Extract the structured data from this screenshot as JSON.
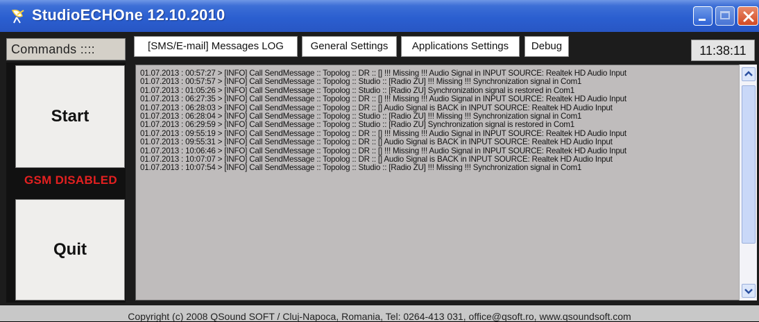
{
  "window": {
    "title": "StudioECHOne 12.10.2010"
  },
  "toolbar": {
    "commands_label": "Commands ::::",
    "tabs": [
      {
        "label": "[SMS/E-mail] Messages LOG"
      },
      {
        "label": "General Settings"
      },
      {
        "label": "Applications Settings"
      },
      {
        "label": "Debug"
      }
    ],
    "clock": "11:38:11"
  },
  "left": {
    "start_label": "Start",
    "gsm_status": "GSM DISABLED",
    "quit_label": "Quit"
  },
  "log": {
    "lines": [
      "01.07.2013 : 00:57:27 > [INFO] Call SendMessage :: Topolog :: DR :: [] !!! Missing !!! Audio Signal in INPUT SOURCE: Realtek HD Audio Input",
      "01.07.2013 : 00:57:57 > [INFO] Call SendMessage :: Topolog :: Studio :: [Radio ZU] !!! Missing !!! Synchronization signal in Com1",
      "01.07.2013 : 01:05:26 > [INFO] Call SendMessage :: Topolog :: Studio :: [Radio ZU] Synchronization signal is restored in Com1",
      "01.07.2013 : 06:27:35 > [INFO] Call SendMessage :: Topolog :: DR :: [] !!! Missing !!! Audio Signal in INPUT SOURCE: Realtek HD Audio Input",
      "01.07.2013 : 06:28:03 > [INFO] Call SendMessage :: Topolog :: DR :: [] Audio Signal is BACK in INPUT SOURCE: Realtek HD Audio Input",
      "01.07.2013 : 06:28:04 > [INFO] Call SendMessage :: Topolog :: Studio :: [Radio ZU] !!! Missing !!! Synchronization signal in Com1",
      "01.07.2013 : 06:29:59 > [INFO] Call SendMessage :: Topolog :: Studio :: [Radio ZU] Synchronization signal is restored in Com1",
      "01.07.2013 : 09:55:19 > [INFO] Call SendMessage :: Topolog :: DR :: [] !!! Missing !!! Audio Signal in INPUT SOURCE: Realtek HD Audio Input",
      "01.07.2013 : 09:55:31 > [INFO] Call SendMessage :: Topolog :: DR :: [] Audio Signal is BACK in INPUT SOURCE: Realtek HD Audio Input",
      "01.07.2013 : 10:06:46 > [INFO] Call SendMessage :: Topolog :: DR :: [] !!! Missing !!! Audio Signal in INPUT SOURCE: Realtek HD Audio Input",
      "01.07.2013 : 10:07:07 > [INFO] Call SendMessage :: Topolog :: DR :: [] Audio Signal is BACK in INPUT SOURCE: Realtek HD Audio Input",
      "01.07.2013 : 10:07:54 > [INFO] Call SendMessage :: Topolog :: Studio :: [Radio ZU] !!! Missing !!! Synchronization signal in Com1"
    ]
  },
  "status_bar": {
    "text": "Copyright (c) 2008 QSound SOFT / Cluj-Napoca, Romania, Tel: 0264-413 031, office@qsoft.ro, www.qsoundsoft.com"
  },
  "colors": {
    "titlebar": "#2b5fd0",
    "gsm_disabled": "#e32020",
    "log_background": "#bfbcbc"
  }
}
